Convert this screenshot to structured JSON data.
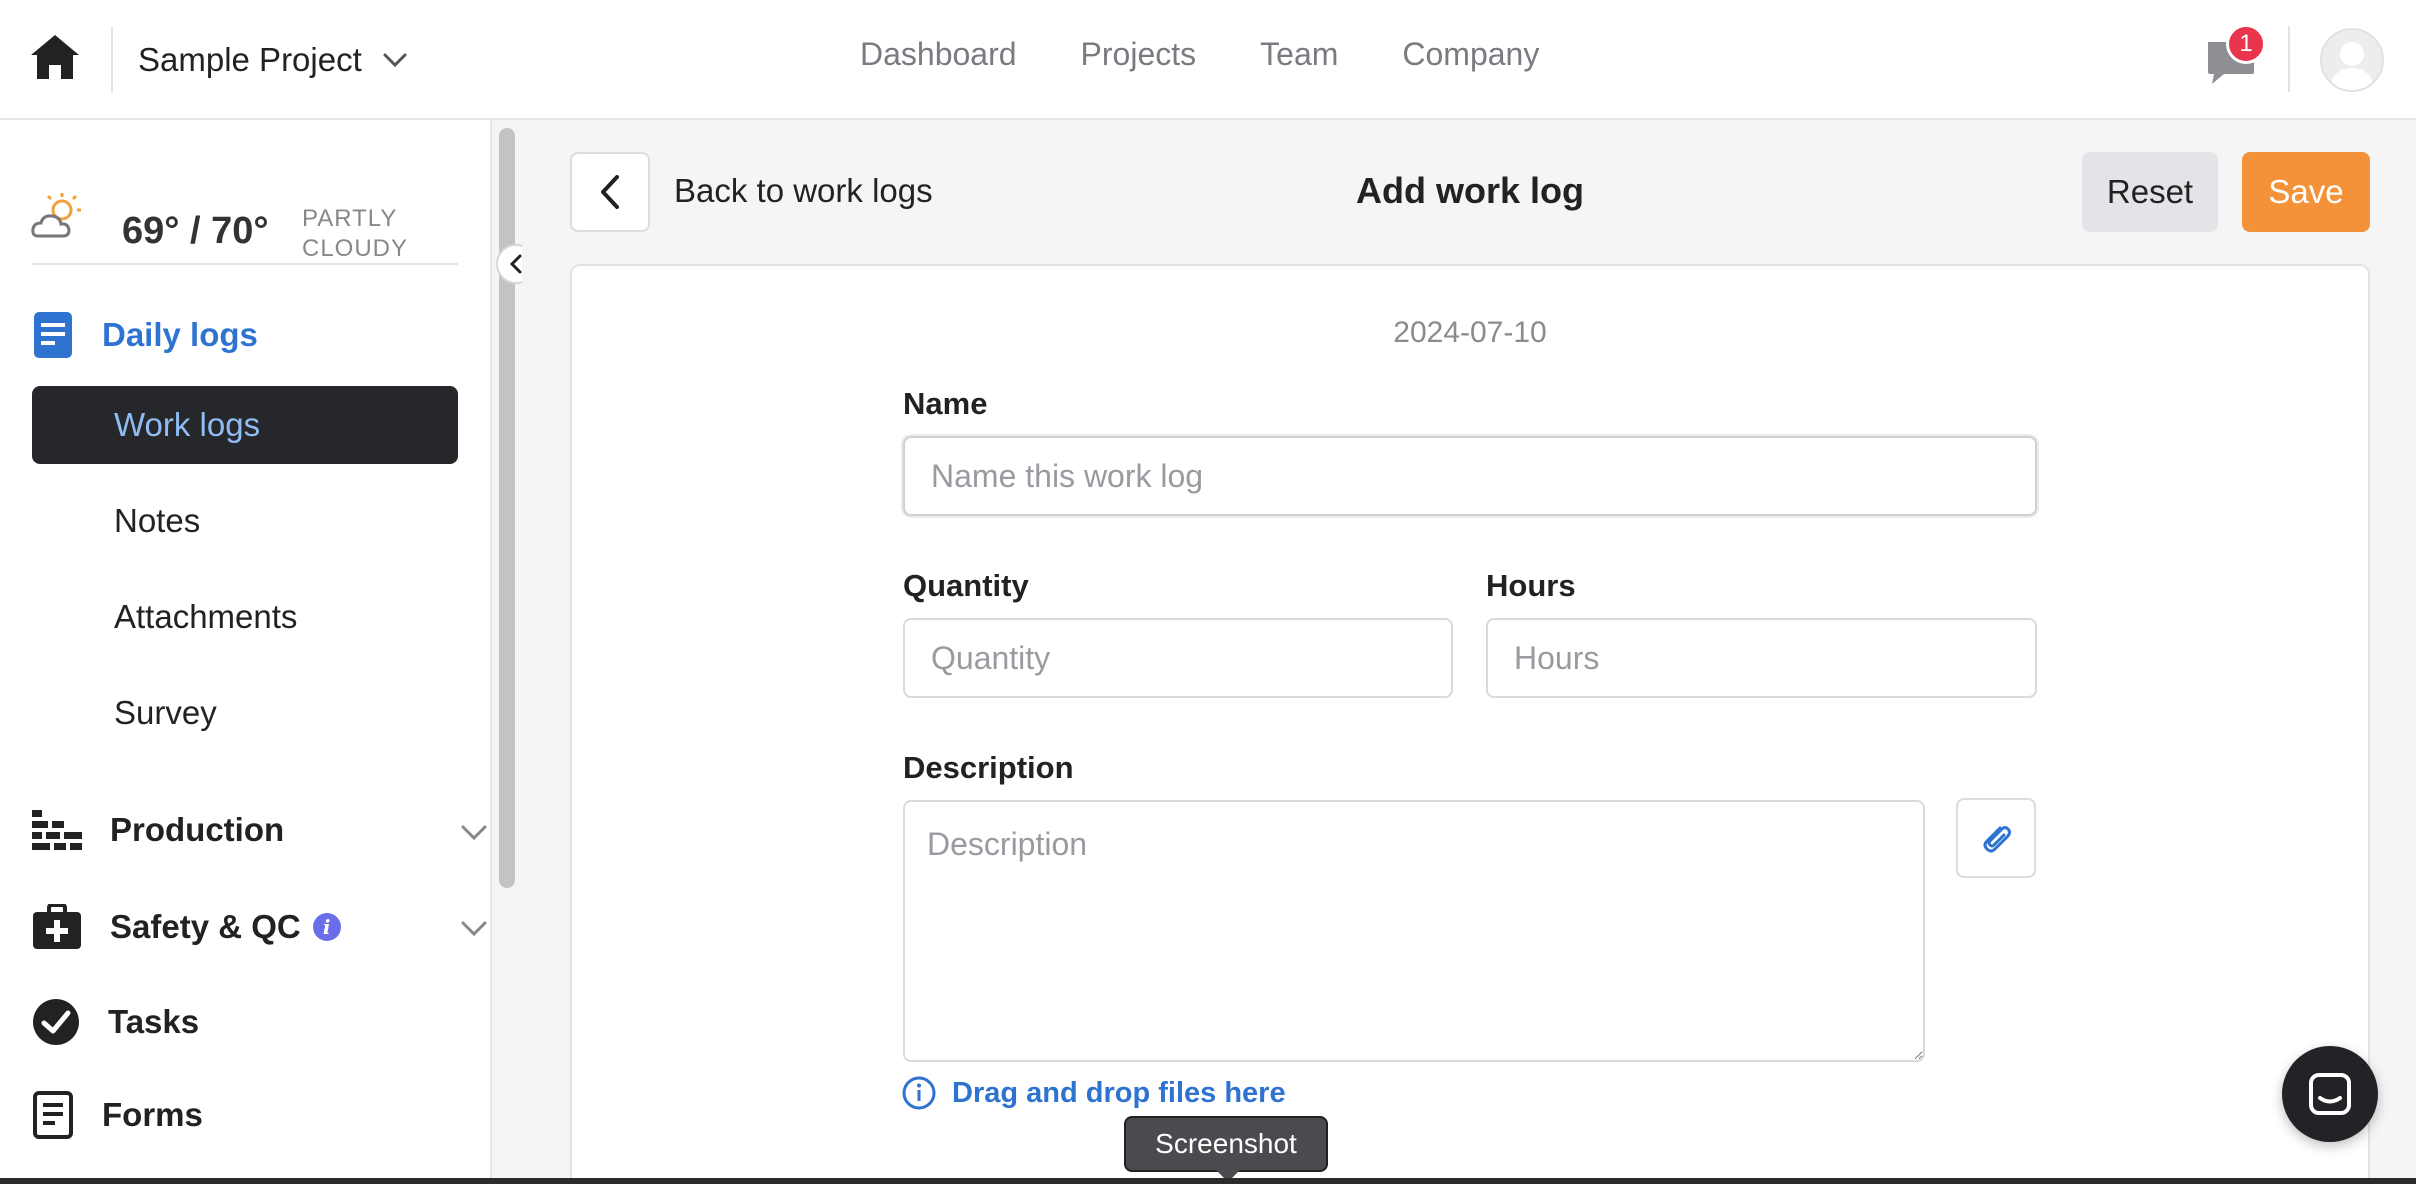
{
  "header": {
    "project_name": "Sample Project",
    "nav": [
      "Dashboard",
      "Projects",
      "Team",
      "Company"
    ],
    "notification_count": "1"
  },
  "sidebar": {
    "weather": {
      "temp": "69° / 70°",
      "condition_line1": "PARTLY",
      "condition_line2": "CLOUDY"
    },
    "sections": {
      "daily_logs": "Daily logs",
      "production": "Production",
      "safety": "Safety & QC",
      "safety_info": "i",
      "tasks": "Tasks",
      "forms": "Forms"
    },
    "sub_items": [
      "Work logs",
      "Notes",
      "Attachments",
      "Survey"
    ]
  },
  "page": {
    "back_label": "Back to work logs",
    "title": "Add work log",
    "reset_label": "Reset",
    "save_label": "Save",
    "date": "2024-07-10"
  },
  "form": {
    "name_label": "Name",
    "name_placeholder": "Name this work log",
    "quantity_label": "Quantity",
    "quantity_placeholder": "Quantity",
    "hours_label": "Hours",
    "hours_placeholder": "Hours",
    "description_label": "Description",
    "description_placeholder": "Description",
    "dnd_text": "Drag and drop files here"
  },
  "overlay": {
    "tooltip": "Screenshot"
  },
  "colors": {
    "accent_blue": "#2f73d0",
    "save_orange": "#f4923a",
    "badge_red": "#e8354b",
    "dark": "#26272b"
  }
}
